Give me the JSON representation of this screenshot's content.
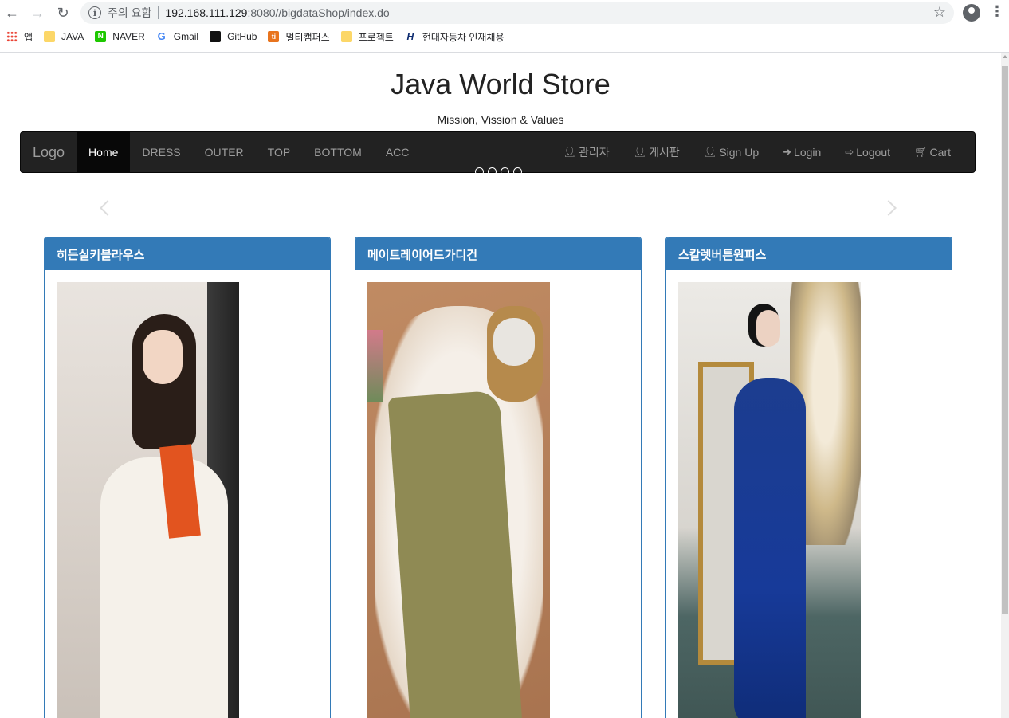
{
  "browser": {
    "warning": "주의 요함",
    "url_host": "192.168.111.129",
    "url_path": ":8080//bigdataShop/index.do"
  },
  "bookmarks": [
    {
      "label": "앱",
      "icon": "apps-icon"
    },
    {
      "label": "JAVA",
      "icon": "folder-icon"
    },
    {
      "label": "NAVER",
      "icon": "naver-icon"
    },
    {
      "label": "Gmail",
      "icon": "google-icon"
    },
    {
      "label": "GitHub",
      "icon": "github-icon"
    },
    {
      "label": "멀티캠퍼스",
      "icon": "multicampus-icon"
    },
    {
      "label": "프로젝트",
      "icon": "folder-icon"
    },
    {
      "label": "현대자동차 인재채용",
      "icon": "hyundai-icon"
    }
  ],
  "header": {
    "title": "Java World Store",
    "subtitle": "Mission, Vission & Values"
  },
  "navbar": {
    "brand": "Logo",
    "left": [
      "Home",
      "DRESS",
      "OUTER",
      "TOP",
      "BOTTOM",
      "ACC"
    ],
    "active": "Home",
    "right": [
      {
        "label": "관리자",
        "icon": "user-icon"
      },
      {
        "label": "게시판",
        "icon": "user-icon"
      },
      {
        "label": "Sign Up",
        "icon": "user-icon"
      },
      {
        "label": "Login",
        "icon": "login-icon"
      },
      {
        "label": "Logout",
        "icon": "logout-icon"
      },
      {
        "label": "Cart",
        "icon": "cart-icon"
      }
    ]
  },
  "products": [
    {
      "name": "히든실키블라우스"
    },
    {
      "name": "메이트레이어드가디건"
    },
    {
      "name": "스칼렛버튼원피스"
    }
  ]
}
